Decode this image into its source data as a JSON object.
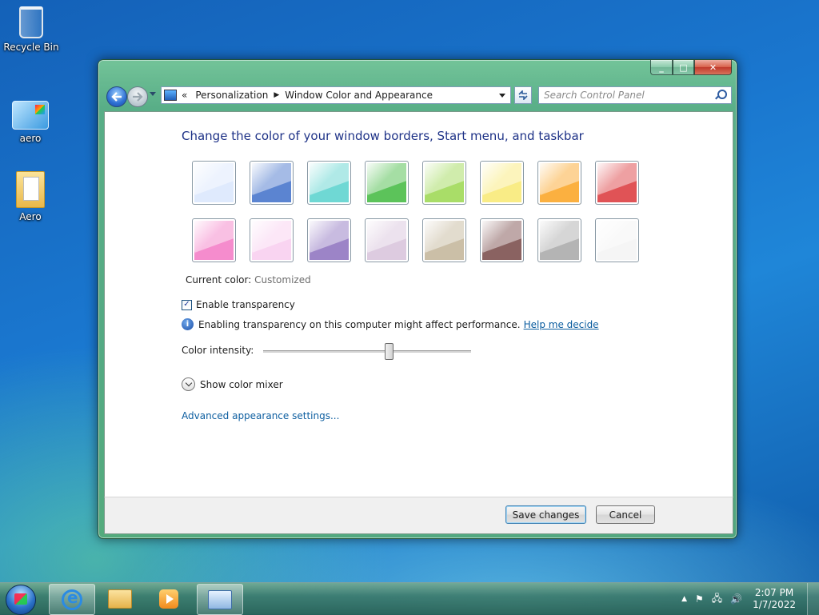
{
  "desktop": {
    "icons": [
      {
        "label": "Recycle Bin"
      },
      {
        "label": "aero"
      },
      {
        "label": "Aero"
      }
    ]
  },
  "window": {
    "breadcrumb": {
      "overflow": "«",
      "items": [
        "Personalization",
        "Window Color and Appearance"
      ]
    },
    "search_placeholder": "Search Control Panel",
    "caption": {
      "minimize": "_",
      "maximize": "□",
      "close": "✕"
    },
    "heading": "Change the color of your window borders, Start menu, and taskbar",
    "swatches": [
      {
        "name": "sky",
        "color": "#dfeafd"
      },
      {
        "name": "twilight",
        "color": "#5b84d1"
      },
      {
        "name": "sea",
        "color": "#6fd8d4"
      },
      {
        "name": "leaf",
        "color": "#5cc35a"
      },
      {
        "name": "lime",
        "color": "#a9dd68"
      },
      {
        "name": "sun",
        "color": "#f9ec86"
      },
      {
        "name": "pumpkin",
        "color": "#fbb040"
      },
      {
        "name": "ruby",
        "color": "#e05356"
      },
      {
        "name": "fuchsia",
        "color": "#f58ccd"
      },
      {
        "name": "blush",
        "color": "#f9d4f1"
      },
      {
        "name": "violet",
        "color": "#9c84c7"
      },
      {
        "name": "lavender",
        "color": "#ddcbe0"
      },
      {
        "name": "taupe",
        "color": "#cbbfa7"
      },
      {
        "name": "chocolate",
        "color": "#8a6261"
      },
      {
        "name": "slate",
        "color": "#b4b4b4"
      },
      {
        "name": "frost",
        "color": "#f5f5f5"
      }
    ],
    "current_color_label": "Current color:",
    "current_color_value": "Customized",
    "transparency_label": "Enable transparency",
    "transparency_checked": true,
    "transparency_check_glyph": "✓",
    "info_text": "Enabling transparency on this computer might affect performance.",
    "help_link": "Help me decide",
    "intensity_label": "Color intensity:",
    "intensity_value": 0.6,
    "mixer_label": "Show color mixer",
    "advanced_link": "Advanced appearance settings...",
    "save_label": "Save changes",
    "cancel_label": "Cancel"
  },
  "taskbar": {
    "items": [
      "start-orb",
      "internet-explorer",
      "windows-explorer",
      "media-player",
      "control-panel"
    ],
    "tray_arrow": "▲",
    "tray_flag": "⚑",
    "tray_network": "🖧",
    "tray_volume": "🔊",
    "time": "2:07 PM",
    "date": "1/7/2022"
  }
}
